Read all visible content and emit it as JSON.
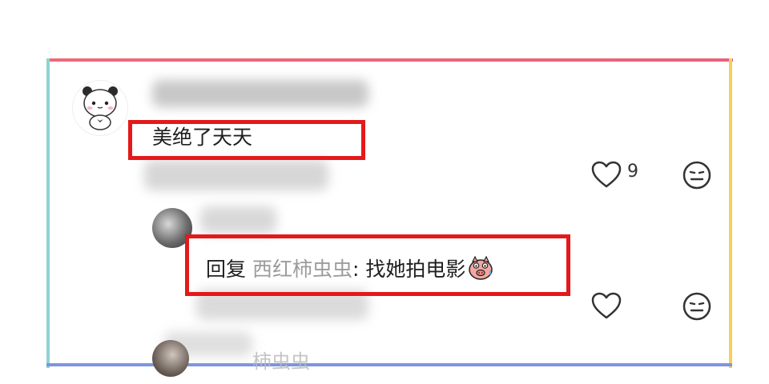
{
  "comment_1": {
    "text": "美绝了天天",
    "like_count": "9"
  },
  "reply_1": {
    "prefix": "回复",
    "mention": "西红柿虫虫",
    "separator": ": ",
    "text": "找她拍电影"
  },
  "comment_3": {
    "partial_name": "柿虫虫"
  },
  "icons": {
    "like": "heart-outline-icon",
    "reaction": "neutral-face-icon",
    "emoji": "pig-face-emoji"
  },
  "colors": {
    "highlight": "#e41919",
    "frame_top": "#ee6a7a",
    "frame_left": "#8fd3d6",
    "frame_right": "#f6cf57",
    "frame_bottom": "#7e95de",
    "mention": "#9c9c9c"
  }
}
